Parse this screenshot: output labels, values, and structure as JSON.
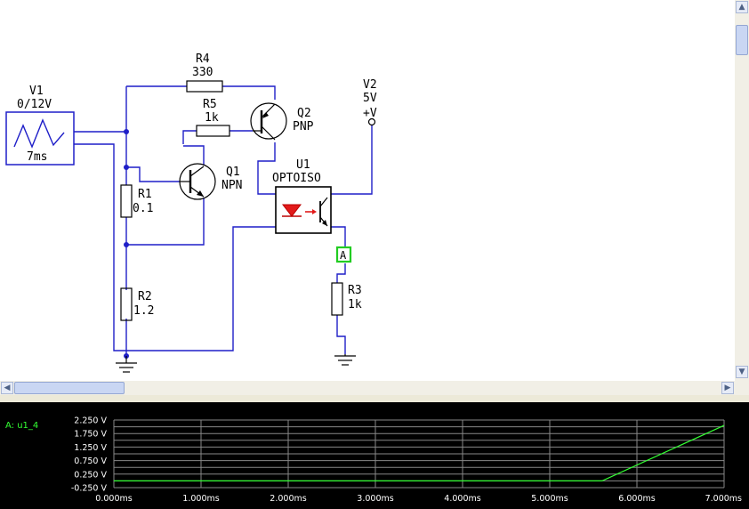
{
  "components": {
    "v1": {
      "name": "V1",
      "value": "0/12V",
      "period": "7ms"
    },
    "r4": {
      "name": "R4",
      "value": "330"
    },
    "r5": {
      "name": "R5",
      "value": "1k"
    },
    "q2": {
      "name": "Q2",
      "type": "PNP"
    },
    "q1": {
      "name": "Q1",
      "type": "NPN"
    },
    "r1": {
      "name": "R1",
      "value": "0.1"
    },
    "r2": {
      "name": "R2",
      "value": "1.2"
    },
    "u1": {
      "name": "U1",
      "type": "OPTOISO"
    },
    "v2": {
      "name": "V2",
      "value": "5V",
      "terminal": "+V"
    },
    "r3": {
      "name": "R3",
      "value": "1k"
    },
    "probe": {
      "label": "A"
    }
  },
  "scope": {
    "trace_label": "A: u1_4",
    "trace_color": "#33ff33",
    "chart_data": {
      "type": "line",
      "ylim": [
        -0.25,
        2.25
      ],
      "xlim": [
        0,
        7
      ],
      "yticks": [
        "2.250 V",
        "1.750 V",
        "1.250 V",
        "0.750 V",
        "0.250 V",
        "-0.250 V"
      ],
      "xticks": [
        "0.000ms",
        "1.000ms",
        "2.000ms",
        "3.000ms",
        "4.000ms",
        "5.000ms",
        "6.000ms",
        "7.000ms"
      ],
      "series": [
        {
          "x": [
            0,
            5.6,
            7.0
          ],
          "y": [
            0.0,
            0.0,
            2.05
          ]
        }
      ]
    }
  }
}
